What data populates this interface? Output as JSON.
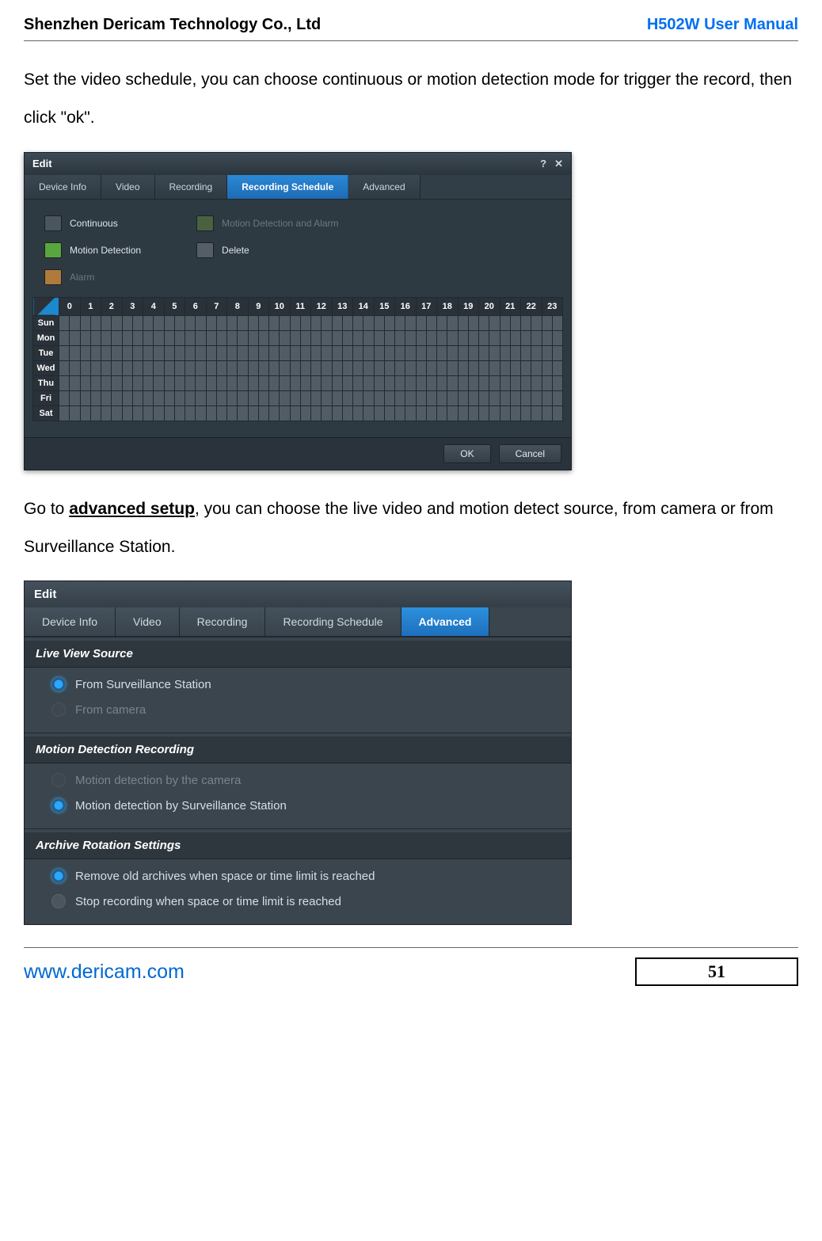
{
  "header": {
    "left": "Shenzhen Dericam Technology Co., Ltd",
    "right": "H502W User Manual"
  },
  "para1": "Set the video schedule, you can choose continuous or motion detection mode for trigger the record, then click \"ok\".",
  "para2a": "Go to ",
  "para2b": "advanced setup",
  "para2c": ", you can choose the live video and motion detect source, from camera or from Surveillance Station.",
  "dlg1": {
    "title": "Edit",
    "tabs": [
      "Device Info",
      "Video",
      "Recording",
      "Recording Schedule",
      "Advanced"
    ],
    "legend": {
      "continuous": "Continuous",
      "motion": "Motion Detection",
      "alarm": "Alarm",
      "md_alarm": "Motion Detection and Alarm",
      "delete": "Delete"
    },
    "hours": [
      "0",
      "1",
      "2",
      "3",
      "4",
      "5",
      "6",
      "7",
      "8",
      "9",
      "10",
      "11",
      "12",
      "13",
      "14",
      "15",
      "16",
      "17",
      "18",
      "19",
      "20",
      "21",
      "22",
      "23"
    ],
    "days": [
      "Sun",
      "Mon",
      "Tue",
      "Wed",
      "Thu",
      "Fri",
      "Sat"
    ],
    "ok": "OK",
    "cancel": "Cancel"
  },
  "dlg2": {
    "title": "Edit",
    "tabs": [
      "Device Info",
      "Video",
      "Recording",
      "Recording Schedule",
      "Advanced"
    ],
    "s1": {
      "title": "Live View Source",
      "r1": "From Surveillance Station",
      "r2": "From camera"
    },
    "s2": {
      "title": "Motion Detection Recording",
      "r1": "Motion detection by the camera",
      "r2": "Motion detection by Surveillance Station"
    },
    "s3": {
      "title": "Archive Rotation Settings",
      "r1": "Remove old archives when space or time limit is reached",
      "r2": "Stop recording when space or time limit is reached"
    }
  },
  "footer": {
    "url": "www.dericam.com",
    "page": "51"
  }
}
